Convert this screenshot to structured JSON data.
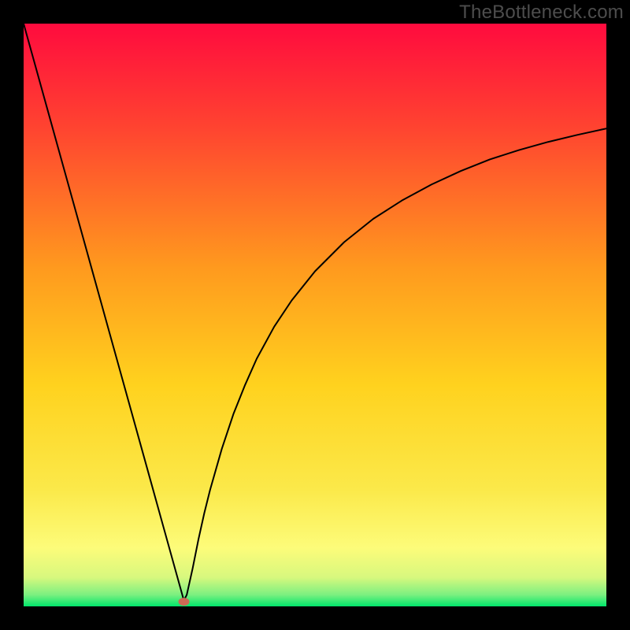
{
  "watermark": "TheBottleneck.com",
  "chart_data": {
    "type": "line",
    "title": "",
    "xlabel": "",
    "ylabel": "",
    "xlim": [
      0,
      100
    ],
    "ylim": [
      0,
      100
    ],
    "background_gradient": {
      "top": "#ff0b3e",
      "mid_upper": "#ff8b1e",
      "mid": "#ffd21e",
      "mid_lower": "#fdfc7a",
      "bottom": "#00e66b"
    },
    "series": [
      {
        "name": "bottleneck-curve",
        "x": [
          0,
          2,
          4,
          6,
          8,
          10,
          12,
          14,
          16,
          18,
          20,
          22,
          24,
          25,
          26,
          27,
          27.5,
          28,
          29,
          30,
          31,
          32,
          34,
          36,
          38,
          40,
          43,
          46,
          50,
          55,
          60,
          65,
          70,
          75,
          80,
          85,
          90,
          95,
          100
        ],
        "values": [
          100,
          92.8,
          85.6,
          78.4,
          71.2,
          64.0,
          56.8,
          49.6,
          42.4,
          35.2,
          28.0,
          20.8,
          13.6,
          10.0,
          6.4,
          2.8,
          1.0,
          2.0,
          6.5,
          11.5,
          16.0,
          20.0,
          27.0,
          33.0,
          38.0,
          42.5,
          48.0,
          52.5,
          57.5,
          62.5,
          66.5,
          69.7,
          72.4,
          74.7,
          76.7,
          78.3,
          79.7,
          80.9,
          82.0
        ]
      }
    ],
    "marker": {
      "name": "optimal-point",
      "x": 27.5,
      "y": 0.8,
      "color": "#cc6a55"
    },
    "grid": false,
    "legend": false
  }
}
